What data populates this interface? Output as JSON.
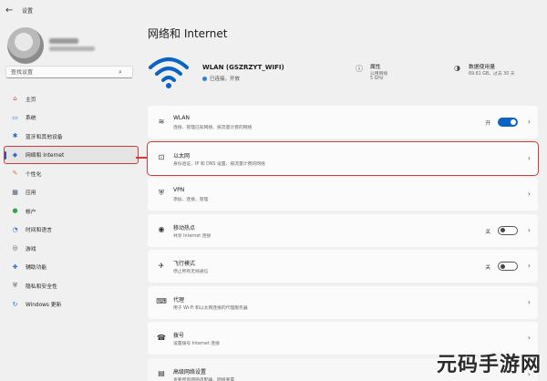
{
  "window": {
    "title": "设置",
    "back_glyph": "←"
  },
  "search": {
    "placeholder": "查找设置"
  },
  "nav": {
    "items": [
      {
        "label": "主页",
        "icon": "home-icon",
        "glyph": "⌂",
        "color": "#c94f3d"
      },
      {
        "label": "系统",
        "icon": "monitor-icon",
        "glyph": "▭",
        "color": "#2b6fc9"
      },
      {
        "label": "蓝牙和其他设备",
        "icon": "bluetooth-icon",
        "glyph": "✱",
        "color": "#2b6fc9"
      },
      {
        "label": "网络和 Internet",
        "icon": "network-icon",
        "glyph": "◆",
        "color": "#2b6fc9"
      },
      {
        "label": "个性化",
        "icon": "brush-icon",
        "glyph": "✎",
        "color": "#c9792b"
      },
      {
        "label": "应用",
        "icon": "apps-icon",
        "glyph": "▦",
        "color": "#46566b"
      },
      {
        "label": "帐户",
        "icon": "person-icon",
        "glyph": "●",
        "color": "#2fa54e"
      },
      {
        "label": "时间和语言",
        "icon": "globe-icon",
        "glyph": "◔",
        "color": "#2b6fc9"
      },
      {
        "label": "游戏",
        "icon": "gamepad-icon",
        "glyph": "◎",
        "color": "#46566b"
      },
      {
        "label": "辅助功能",
        "icon": "accessibility-icon",
        "glyph": "✚",
        "color": "#2b6fc9"
      },
      {
        "label": "隐私和安全性",
        "icon": "shield-icon",
        "glyph": "⛨",
        "color": "#46566b"
      },
      {
        "label": "Windows 更新",
        "icon": "update-icon",
        "glyph": "↻",
        "color": "#2b6fc9"
      }
    ]
  },
  "main": {
    "title": "网络和 Internet",
    "network": {
      "name": "WLAN (GSZRZYT_WIFI)",
      "status": "已连接，开放"
    },
    "properties": {
      "title": "属性",
      "lines": [
        "公用网络",
        "5 GHz"
      ]
    },
    "data_usage": {
      "title": "数据使用量",
      "lines": [
        "69.61 GB，过去 30 天"
      ]
    },
    "rows": [
      {
        "title": "WLAN",
        "desc": "连接、管理已知网络、按流量计费的网络",
        "icon": "wifi-icon",
        "glyph": "≋",
        "toggle": "on",
        "toggle_label": "开"
      },
      {
        "title": "以太网",
        "desc": "身份验证、IP 和 DNS 设置、按流量计费的网络",
        "icon": "ethernet-icon",
        "glyph": "⊡"
      },
      {
        "title": "VPN",
        "desc": "添加、连接、管理",
        "icon": "vpn-shield-icon",
        "glyph": "⛨"
      },
      {
        "title": "移动热点",
        "desc": "共享 Internet 连接",
        "icon": "hotspot-icon",
        "glyph": "◉",
        "toggle": "off",
        "toggle_label": "关"
      },
      {
        "title": "飞行模式",
        "desc": "停止所有无线通信",
        "icon": "airplane-icon",
        "glyph": "✈",
        "toggle": "off",
        "toggle_label": "关"
      },
      {
        "title": "代理",
        "desc": "用于 Wi-Fi 和以太网连接的代理服务器",
        "icon": "proxy-icon",
        "glyph": "⌨"
      },
      {
        "title": "拨号",
        "desc": "设置拨号 Internet 连接",
        "icon": "dialup-icon",
        "glyph": "☎"
      },
      {
        "title": "高级网络设置",
        "desc": "查看所有网络适配器，网络重置",
        "icon": "server-icon",
        "glyph": "▤"
      }
    ]
  },
  "watermark": {
    "text": "元码手游网"
  },
  "colors": {
    "accent": "#0b63c5",
    "highlight": "#d03a3a"
  }
}
